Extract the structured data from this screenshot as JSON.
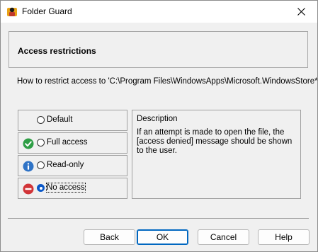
{
  "window": {
    "title": "Folder Guard"
  },
  "header": {
    "title": "Access restrictions"
  },
  "prompt": "How to restrict access to 'C:\\Program Files\\WindowsApps\\Microsoft.WindowsStore*':",
  "options": [
    {
      "label": "Default",
      "icon": "none",
      "selected": false
    },
    {
      "label": "Full access",
      "icon": "green-check-icon",
      "selected": false
    },
    {
      "label": "Read-only",
      "icon": "blue-info-icon",
      "selected": false
    },
    {
      "label": "No access",
      "icon": "red-no-entry-icon",
      "selected": true
    }
  ],
  "description": {
    "title": "Description",
    "text": "If an attempt is made to open the file, the [access denied] message should be shown to the user."
  },
  "buttons": {
    "back": "Back",
    "ok": "OK",
    "cancel": "Cancel",
    "help": "Help"
  },
  "colors": {
    "accent": "#0067c0",
    "full_access": "#2e9e45",
    "read_only": "#2f73c6",
    "no_access": "#d13438"
  }
}
